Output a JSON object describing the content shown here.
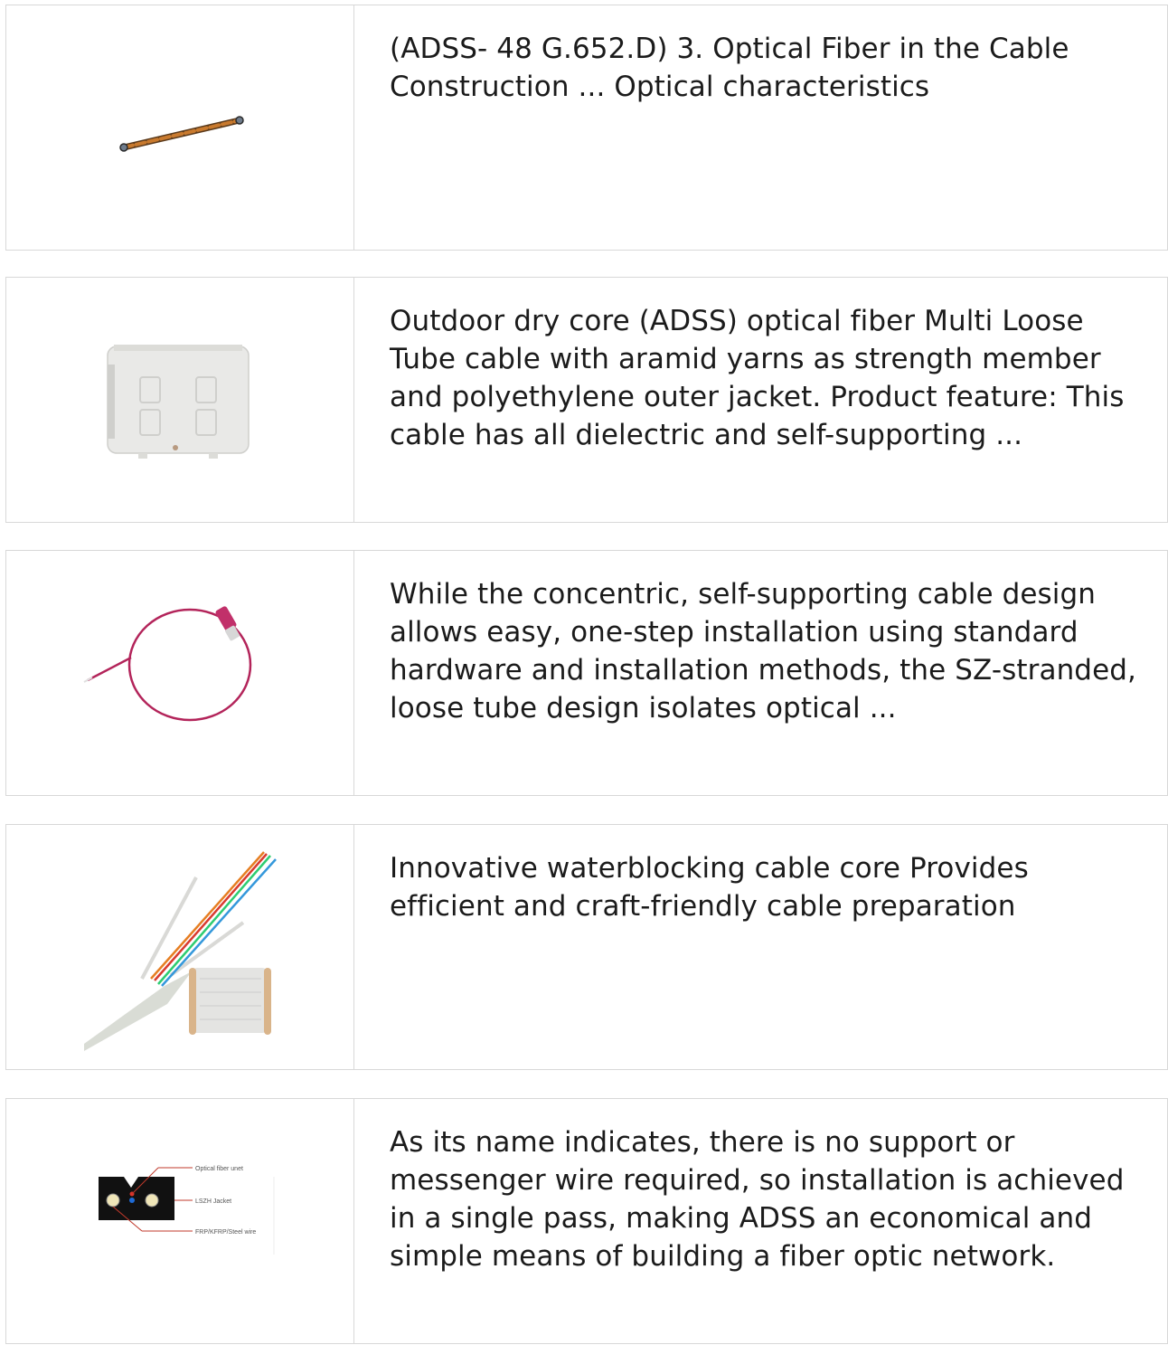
{
  "products": [
    {
      "image_icon": "adss-cable-rod-image",
      "description": "(ADSS- 48 G.652.D) 3. Optical Fiber in the Cable Construction ... Optical characteristics"
    },
    {
      "image_icon": "fiber-distribution-box-image",
      "description": "Outdoor dry core (ADSS) optical fiber Multi Loose Tube cable with aramid yarns as strength member and polyethylene outer jacket. Product feature: This cable has all dielectric and self-supporting ..."
    },
    {
      "image_icon": "fiber-pigtail-image",
      "description": "While the concentric, self-supporting cable design allows easy, one-step installation using standard hardware and installation methods, the SZ-stranded, loose tube design isolates optical ..."
    },
    {
      "image_icon": "drop-cable-spool-image",
      "description": "Innovative waterblocking cable core Provides efficient and craft-friendly cable preparation"
    },
    {
      "image_icon": "drop-cable-cross-section-image",
      "description": "As its name indicates, there is no support or messenger wire required, so installation is achieved in a single pass, making ADSS an economical and simple means of building a fiber optic network.",
      "diagram_labels": [
        "Optical fiber unet",
        "LSZH Jacket",
        "FRP/KFRP/Steel wire"
      ]
    }
  ],
  "colors": {
    "border": "#d8d8d8",
    "text": "#1b1b1b",
    "cable_orange": "#c97a2e",
    "pigtail_magenta": "#b3245a"
  }
}
